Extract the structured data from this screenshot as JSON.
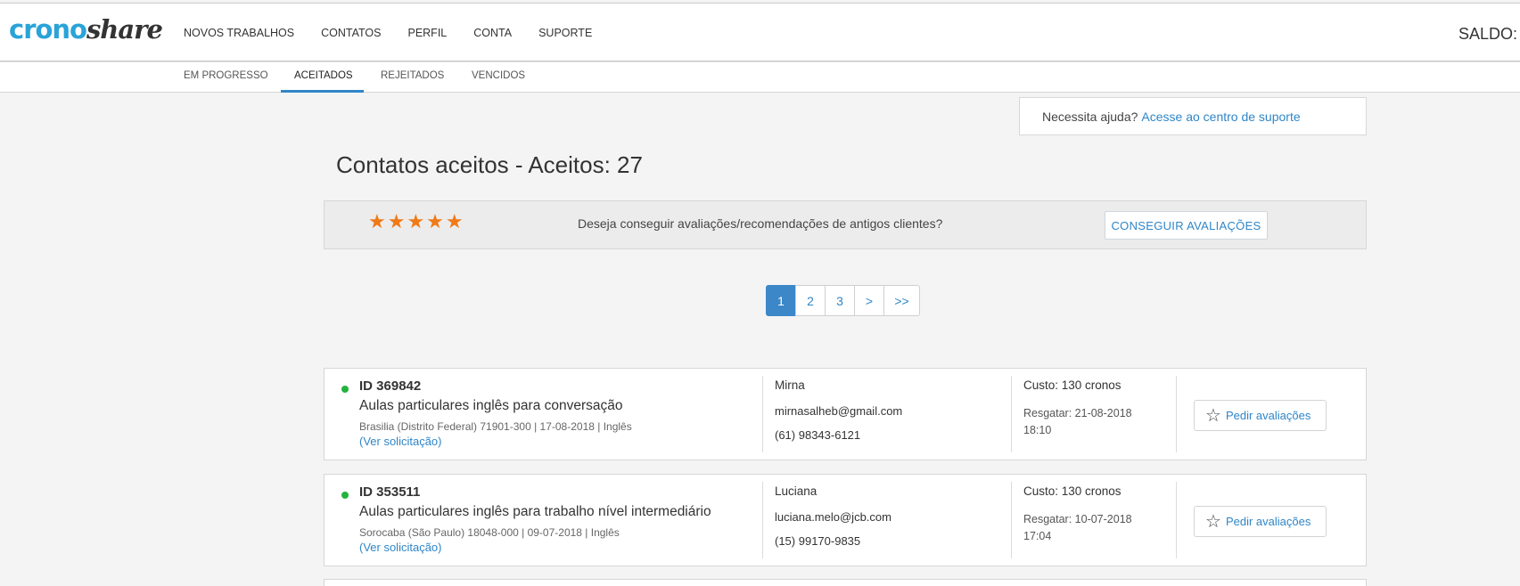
{
  "logo": {
    "part1": "crono",
    "part2": "share"
  },
  "nav": {
    "items": [
      "NOVOS TRABALHOS",
      "CONTATOS",
      "PERFIL",
      "CONTA",
      "SUPORTE"
    ],
    "saldo": "SALDO:"
  },
  "subnav": {
    "items": [
      "EM PROGRESSO",
      "ACEITADOS",
      "REJEITADOS",
      "VENCIDOS"
    ],
    "active": "ACEITADOS"
  },
  "help": {
    "question": "Necessita ajuda?",
    "link": "Acesse ao centro de suporte"
  },
  "page": {
    "title": "Contatos aceitos - Aceitos: 27"
  },
  "review": {
    "stars": "★★★★★",
    "text": "Deseja conseguir avaliações/recomendações de antigos clientes?",
    "button": "CONSEGUIR AVALIAÇÕES"
  },
  "pagination": {
    "pages": [
      "1",
      "2",
      "3",
      ">",
      ">>"
    ],
    "current": "1"
  },
  "jobs": [
    {
      "id": "ID 369842",
      "title": "Aulas particulares inglês para conversação",
      "meta": "Brasilia (Distrito Federal) 71901-300 | 17-08-2018 | Inglês",
      "link": "(Ver solicitação)",
      "name": "Mirna",
      "email": "mirnasalheb@gmail.com",
      "phone": "(61) 98343-6121",
      "cost": "Custo: 130 cronos",
      "redeem": "Resgatar: 21-08-2018 18:10",
      "button": "Pedir avaliações"
    },
    {
      "id": "ID 353511",
      "title": "Aulas particulares inglês para trabalho nível intermediário",
      "meta": "Sorocaba (São Paulo) 18048-000 | 09-07-2018 | Inglês",
      "link": "(Ver solicitação)",
      "name": "Luciana",
      "email": "luciana.melo@jcb.com",
      "phone": "(15) 99170-9835",
      "cost": "Custo: 130 cronos",
      "redeem": "Resgatar: 10-07-2018 17:04",
      "button": "Pedir avaliações"
    }
  ],
  "colors": {
    "accent": "#2f86c8",
    "star": "#f07a17",
    "status_active": "#22b43c"
  }
}
